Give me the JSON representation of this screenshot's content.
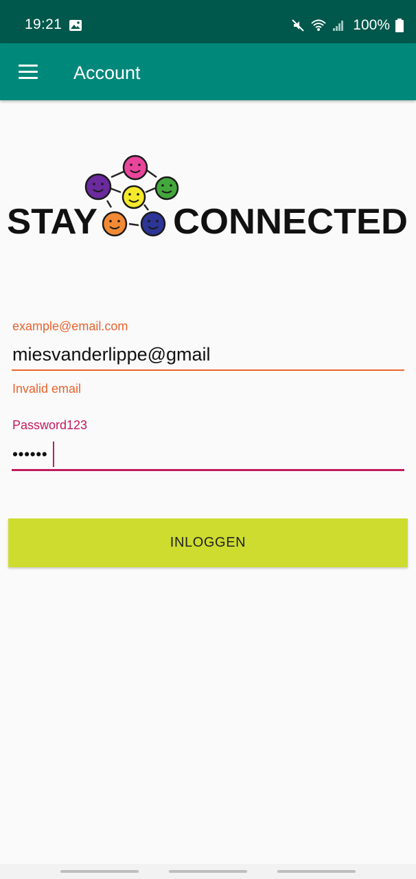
{
  "status_bar": {
    "time": "19:21",
    "battery_percent": "100%",
    "icons": [
      "image-icon",
      "mute-icon",
      "wifi-icon",
      "signal-icon",
      "battery-icon"
    ]
  },
  "app_bar": {
    "menu_icon": "menu-icon",
    "title": "Account",
    "color": "#00887a"
  },
  "logo": {
    "left_text": "STAY",
    "right_text": "CONNECTED",
    "faces": [
      "pink",
      "purple",
      "yellow",
      "green",
      "orange",
      "blue"
    ]
  },
  "email": {
    "placeholder": "example@email.com",
    "value": "miesvanderlippe@gmail",
    "error": "Invalid email",
    "color": "#e8622d"
  },
  "password": {
    "placeholder": "Password123",
    "masked_value": "••••••",
    "color": "#c2185b"
  },
  "login_button": {
    "label": "INLOGGEN",
    "color": "#cddc2e"
  }
}
